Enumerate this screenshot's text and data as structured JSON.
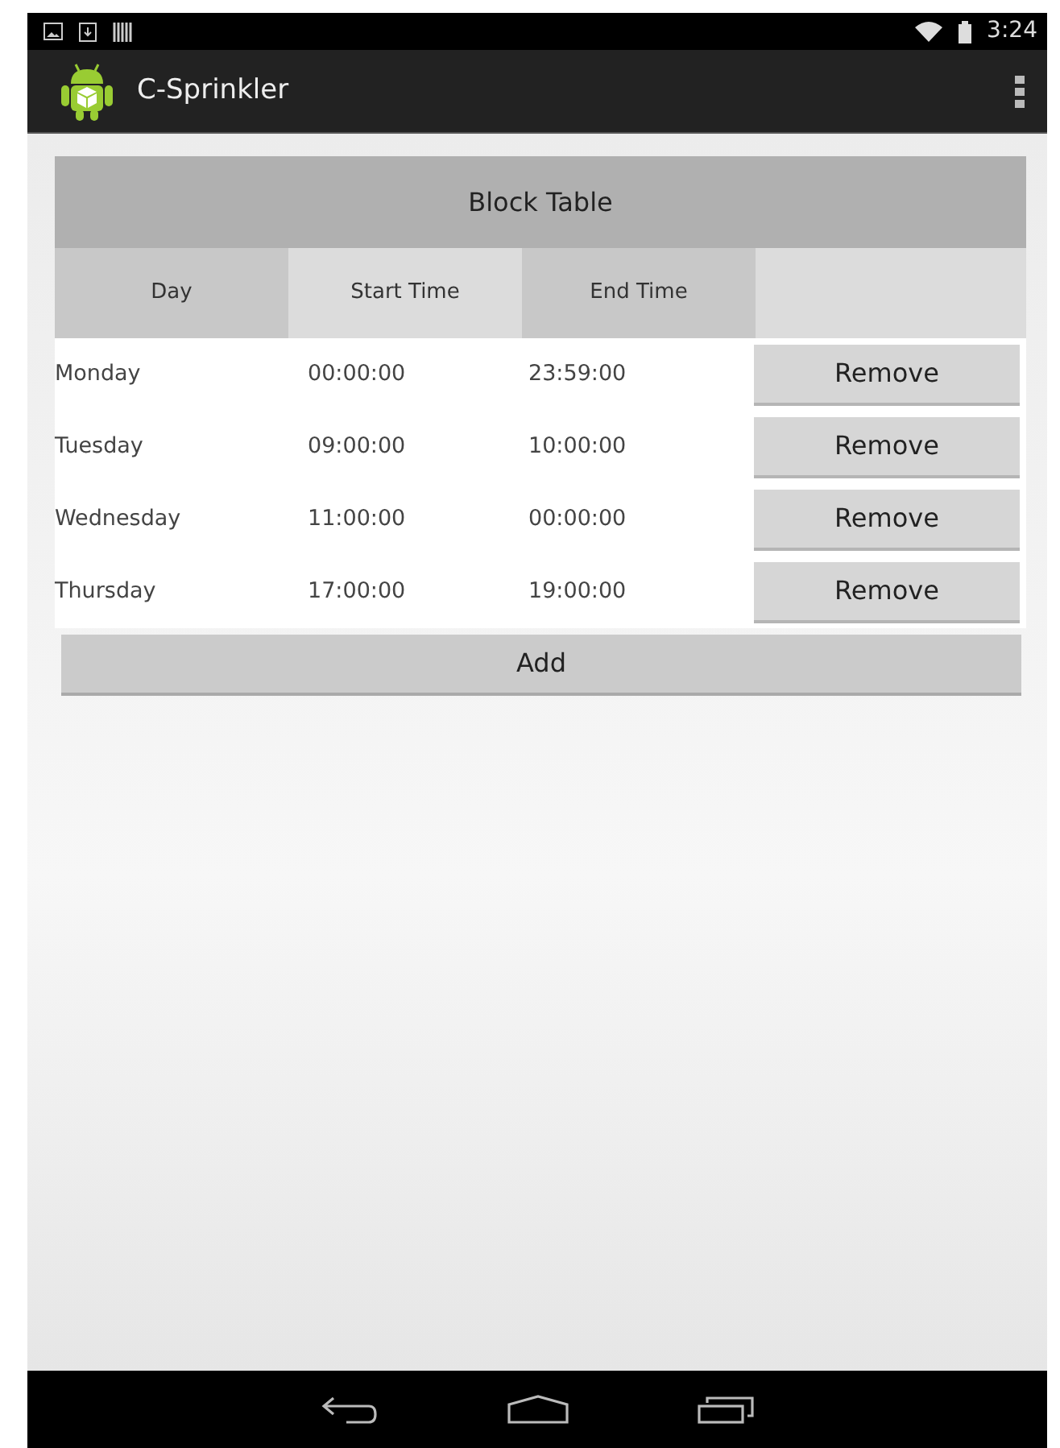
{
  "status_bar": {
    "time": "3:24"
  },
  "action_bar": {
    "title": "C-Sprinkler"
  },
  "block_table": {
    "title": "Block Table",
    "columns": [
      "Day",
      "Start Time",
      "End Time"
    ],
    "rows": [
      {
        "day": "Monday",
        "start": "00:00:00",
        "end": "23:59:00",
        "button": "Remove"
      },
      {
        "day": "Tuesday",
        "start": "09:00:00",
        "end": "10:00:00",
        "button": "Remove"
      },
      {
        "day": "Wednesday",
        "start": "11:00:00",
        "end": "00:00:00",
        "button": "Remove"
      },
      {
        "day": "Thursday",
        "start": "17:00:00",
        "end": "19:00:00",
        "button": "Remove"
      }
    ]
  },
  "add_button": "Add"
}
